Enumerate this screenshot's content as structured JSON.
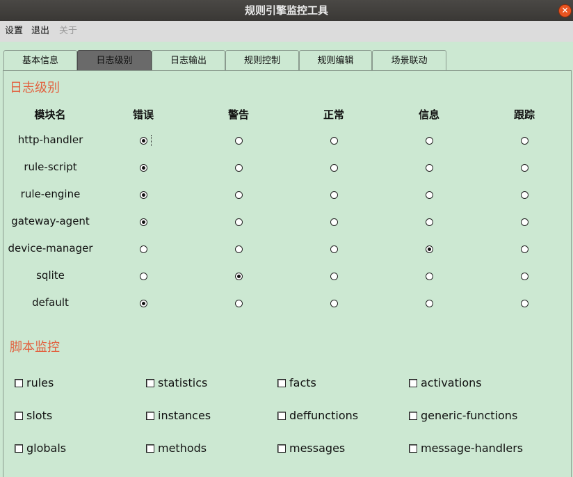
{
  "window": {
    "title": "规则引擎监控工具",
    "close_symbol": "✕"
  },
  "menu": [
    {
      "label": "设置",
      "enabled": true
    },
    {
      "label": "退出",
      "enabled": true
    },
    {
      "label": "关于",
      "enabled": false
    }
  ],
  "tabs": [
    {
      "label": "基本信息",
      "active": false
    },
    {
      "label": "日志级别",
      "active": true
    },
    {
      "label": "日志输出",
      "active": false
    },
    {
      "label": "规则控制",
      "active": false
    },
    {
      "label": "规则编辑",
      "active": false
    },
    {
      "label": "场景联动",
      "active": false
    }
  ],
  "log_levels": {
    "section_title": "日志级别",
    "module_header": "模块名",
    "levels": [
      "错误",
      "警告",
      "正常",
      "信息",
      "跟踪"
    ],
    "modules": [
      {
        "name": "http-handler",
        "selected": 0
      },
      {
        "name": "rule-script",
        "selected": 0
      },
      {
        "name": "rule-engine",
        "selected": 0
      },
      {
        "name": "gateway-agent",
        "selected": 0
      },
      {
        "name": "device-manager",
        "selected": 3
      },
      {
        "name": "sqlite",
        "selected": 1
      },
      {
        "name": "default",
        "selected": 0
      }
    ]
  },
  "script_monitor": {
    "section_title": "脚本监控",
    "items": [
      {
        "label": "rules",
        "checked": false
      },
      {
        "label": "statistics",
        "checked": false
      },
      {
        "label": "facts",
        "checked": false
      },
      {
        "label": "activations",
        "checked": false
      },
      {
        "label": "slots",
        "checked": false
      },
      {
        "label": "instances",
        "checked": false
      },
      {
        "label": "deffunctions",
        "checked": false
      },
      {
        "label": "generic-functions",
        "checked": false
      },
      {
        "label": "globals",
        "checked": false
      },
      {
        "label": "methods",
        "checked": false
      },
      {
        "label": "messages",
        "checked": false
      },
      {
        "label": "message-handlers",
        "checked": false
      }
    ]
  }
}
